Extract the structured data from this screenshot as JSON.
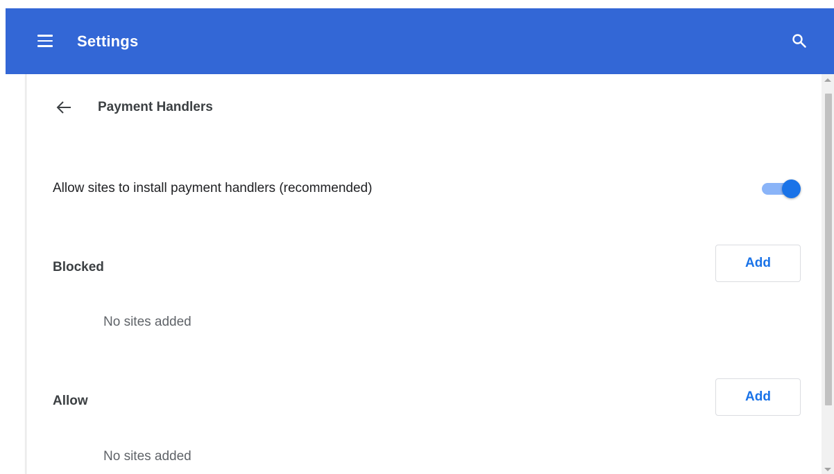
{
  "app": {
    "title": "Settings"
  },
  "icons": {
    "menu": "hamburger-menu-icon",
    "search": "search-icon",
    "back": "arrow-left-icon"
  },
  "page": {
    "title": "Payment Handlers"
  },
  "setting": {
    "label": "Allow sites to install payment handlers (recommended)",
    "enabled": true
  },
  "sections": {
    "blocked": {
      "label": "Blocked",
      "add_label": "Add",
      "empty_text": "No sites added"
    },
    "allow": {
      "label": "Allow",
      "add_label": "Add",
      "empty_text": "No sites added"
    }
  },
  "colors": {
    "header": "#3367d6",
    "accent": "#1a73e8",
    "toggle_track": "#8ab4f8"
  }
}
